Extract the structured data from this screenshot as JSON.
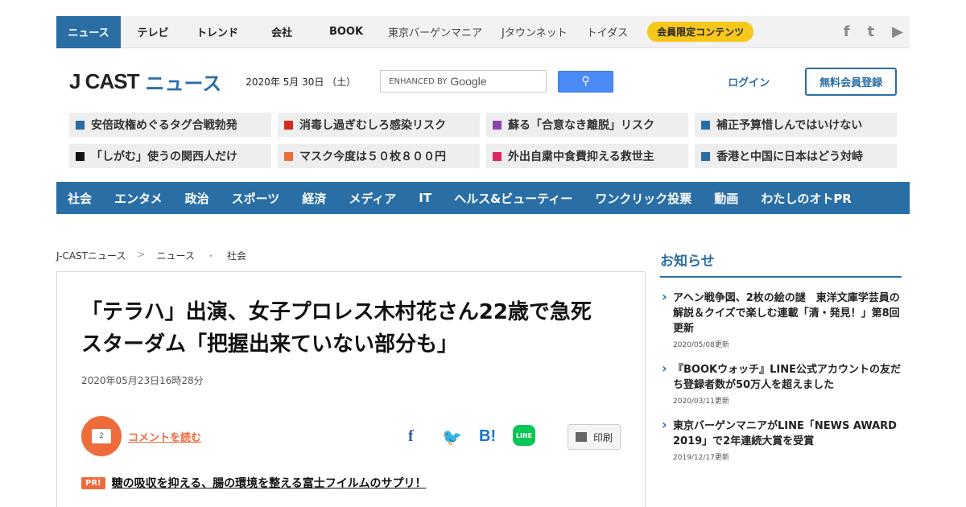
{
  "topbar": {
    "tabs": [
      "ニュース",
      "テレビ",
      "トレンド",
      "会社",
      "BOOK"
    ],
    "sub_links": [
      "東京バーゲンマニア",
      "Jタウンネット",
      "トイダス"
    ],
    "member_label": "会員限定コンテンツ",
    "social": [
      "f",
      "t",
      "▶"
    ]
  },
  "header": {
    "logo_main": "J CAST",
    "logo_news": "ニュース",
    "date": "2020年 5月 30日 （土）",
    "search_prefix": "ENHANCED BY",
    "search_brand": "Google",
    "search_button": "⚲",
    "login": "ログイン",
    "register": "無料会員登録"
  },
  "topics": [
    {
      "label": "安倍政権めぐるタグ合戦勃発",
      "color": "#2a6ea6"
    },
    {
      "label": "消毒し過ぎむしろ感染リスク",
      "color": "#d22b1b"
    },
    {
      "label": "蘇る「合意なき離脱」リスク",
      "color": "#8e44ad"
    },
    {
      "label": "補正予算惜しんではいけない",
      "color": "#2a6ea6"
    },
    {
      "label": "「しがむ」使うの関西人だけ",
      "color": "#111111"
    },
    {
      "label": "マスク今度は５０枚８００円",
      "color": "#ee6b3b"
    },
    {
      "label": "外出自粛中食費抑える救世主",
      "color": "#e0245e"
    },
    {
      "label": "香港と中国に日本はどう対峙",
      "color": "#2a6ea6"
    }
  ],
  "nav": [
    "社会",
    "エンタメ",
    "政治",
    "スポーツ",
    "経済",
    "メディア",
    "IT",
    "ヘルス&ビューティー",
    "ワンクリック投票",
    "動画",
    "わたしのオトPR"
  ],
  "breadcrumb": [
    "J-CASTニュース",
    ">",
    "ニュース",
    "・",
    "社会"
  ],
  "article": {
    "headline": "「テラハ」出演、女子プロレス木村花さん22歳で急死　スターダム「把握出来ていない部分も」",
    "date": "2020年05月23日16時28分",
    "comment_count": "2",
    "comment_link": "コメントを読む",
    "share": {
      "fb": "f",
      "tw": "🐦",
      "hb": "B!",
      "line": "LINE"
    },
    "print_label": "印刷",
    "pr_badge": "PR!",
    "pr_text": "糖の吸収を抑える、腸の環境を整える富士フイルムのサプリ！"
  },
  "sidebar": {
    "title": "お知らせ",
    "notices": [
      {
        "title": "アヘン戦争図、2枚の絵の謎　東洋文庫学芸員の解説＆クイズで楽しむ連載「清・発見！」第8回更新",
        "date": "2020/05/08更新"
      },
      {
        "title": "『BOOKウォッチ』LINE公式アカウントの友だち登録者数が50万人を超えました",
        "date": "2020/03/11更新"
      },
      {
        "title": "東京バーゲンマニアがLINE「NEWS AWARD 2019」で2年連続大賞を受賞",
        "date": "2019/12/17更新"
      }
    ]
  }
}
